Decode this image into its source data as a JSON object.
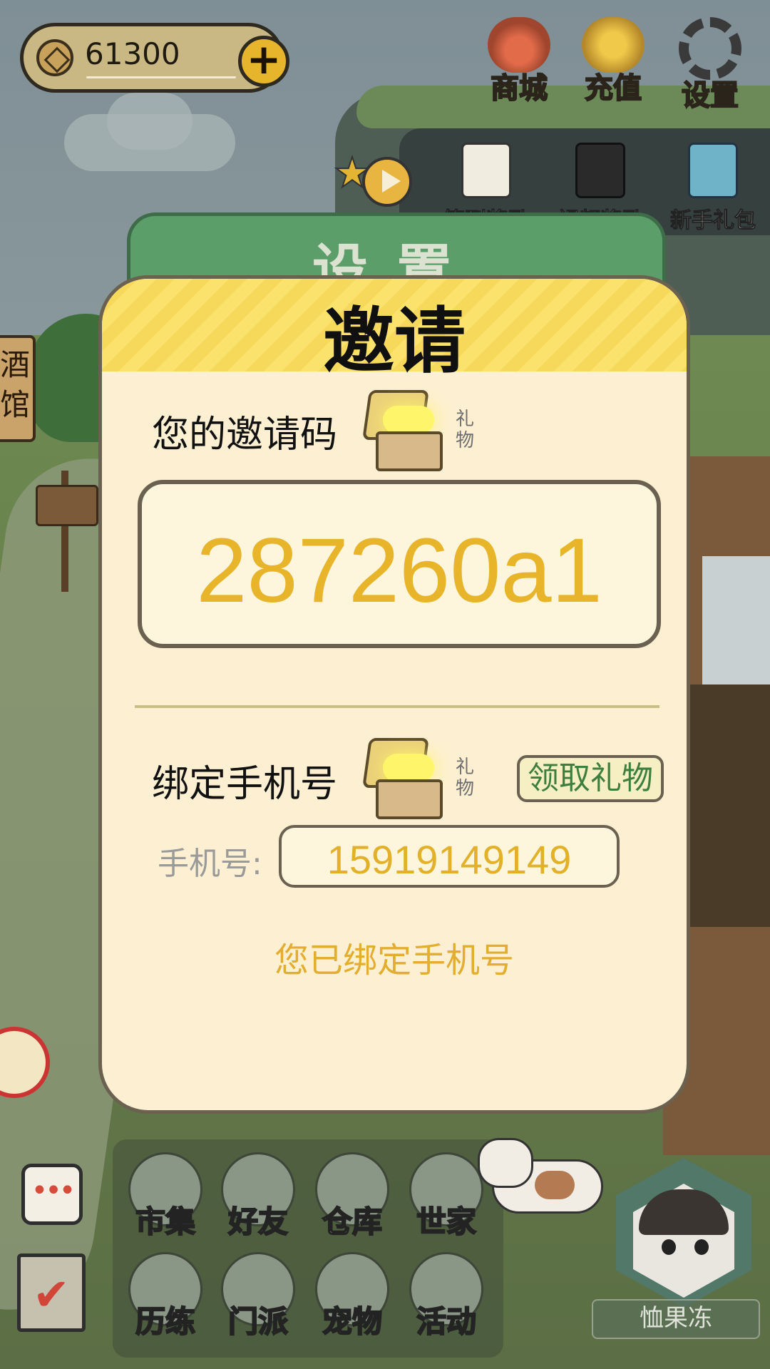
{
  "hud": {
    "coins": "61300",
    "top_buttons": [
      {
        "label": "商城",
        "icon": "shop-bag-icon"
      },
      {
        "label": "充值",
        "icon": "gold-ingot-icon"
      },
      {
        "label": "设置",
        "icon": "gear-icon"
      }
    ],
    "reward_buttons": [
      {
        "label": "签到奖励",
        "icon": "calendar-icon"
      },
      {
        "label": "视频奖励",
        "icon": "clapperboard-icon"
      },
      {
        "label": "新手礼包",
        "icon": "treasure-chest-icon"
      }
    ]
  },
  "background": {
    "settings_panel_title": "设置",
    "side_sign": "酒馆"
  },
  "dialog": {
    "title": "邀请",
    "invite_code_label": "您的邀请码",
    "gift_caption": "礼物",
    "invite_code": "287260a1",
    "bind_phone_label": "绑定手机号",
    "claim_gift_button": "领取礼物",
    "phone_label": "手机号:",
    "phone_value": "15919149149",
    "bound_status": "您已绑定手机号"
  },
  "bottom_menu": [
    {
      "label": "市集",
      "icon": "market-icon"
    },
    {
      "label": "好友",
      "icon": "handshake-icon"
    },
    {
      "label": "仓库",
      "icon": "chest-icon"
    },
    {
      "label": "世家",
      "icon": "teapot-icon"
    },
    {
      "label": "历练",
      "icon": "crossed-swords-icon"
    },
    {
      "label": "门派",
      "icon": "banner-icon"
    },
    {
      "label": "宠物",
      "icon": "paw-icon"
    },
    {
      "label": "活动",
      "icon": "lantern-icon"
    }
  ],
  "player": {
    "name": "恤果冻"
  },
  "colors": {
    "dialog_bg": "#fdf0d2",
    "header_yellow": "#fae26c",
    "code_yellow": "#e8b42a",
    "claim_green": "#3e7f3f",
    "settings_green": "#5c9e6a"
  }
}
